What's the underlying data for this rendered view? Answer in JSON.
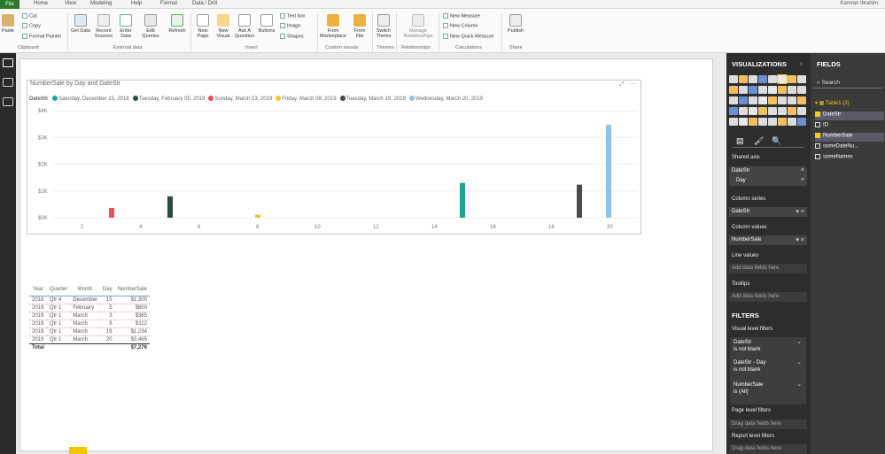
{
  "tabs": {
    "file": "File",
    "home": "Home",
    "view": "View",
    "modeling": "Modeling",
    "help": "Help",
    "format": "Format",
    "data_drill": "Data / Drill",
    "user": "Kamran Ibrahim"
  },
  "ribbon": {
    "paste": "Paste",
    "cut": "Cut",
    "copy": "Copy",
    "format_painter": "Format Painter",
    "get_data": "Get Data",
    "recent_sources": "Recent Sources",
    "enter_data": "Enter Data",
    "edit_queries": "Edit Queries",
    "refresh": "Refresh",
    "new_page": "New Page",
    "new_visual": "New Visual",
    "ask_question": "Ask A Question",
    "buttons": "Buttons",
    "text_box": "Text box",
    "image": "Image",
    "shapes": "Shapes",
    "from_marketplace": "From Marketplace",
    "from_file": "From File",
    "switch_theme": "Switch Theme",
    "manage_relationships": "Manage Relationships",
    "new_measure": "New Measure",
    "new_column": "New Column",
    "new_quick_measure": "New Quick Measure",
    "publish": "Publish",
    "groups": {
      "clipboard": "Clipboard",
      "external_data": "External data",
      "insert": "Insert",
      "custom_visuals": "Custom visuals",
      "themes": "Themes",
      "relationships": "Relationships",
      "calculations": "Calculations",
      "share": "Share"
    }
  },
  "visual": {
    "title": "NumberSale by Day and DateStr",
    "legend_title": "DateStr",
    "expand_icon": "focus-mode-icon",
    "more_icon": "more-options-icon"
  },
  "legend": [
    {
      "label": "Saturday, December 15, 2018",
      "color": "#1aa692"
    },
    {
      "label": "Tuesday, February 05, 2019",
      "color": "#2f4b40"
    },
    {
      "label": "Sunday, March 03, 2019",
      "color": "#e6505a"
    },
    {
      "label": "Friday, March 08, 2019",
      "color": "#f2c230"
    },
    {
      "label": "Tuesday, March 19, 2019",
      "color": "#4a4a48"
    },
    {
      "label": "Wednesday, March 20, 2019",
      "color": "#8ac3ec"
    }
  ],
  "chart_data": {
    "type": "bar",
    "title": "NumberSale by Day and DateStr",
    "x_ticks": [
      "2",
      "4",
      "6",
      "8",
      "10",
      "12",
      "14",
      "16",
      "18",
      "20"
    ],
    "y_ticks": [
      "$0K",
      "$1K",
      "$2K",
      "$3K",
      "$4K"
    ],
    "xlim": [
      1,
      21
    ],
    "ylim": [
      0,
      4000
    ],
    "series": [
      {
        "name": "Saturday, December 15, 2018",
        "x": 15,
        "y": 1300,
        "color": "#1aa692"
      },
      {
        "name": "Tuesday, February 05, 2019",
        "x": 5,
        "y": 800,
        "color": "#2f4b40"
      },
      {
        "name": "Sunday, March 03, 2019",
        "x": 3,
        "y": 365,
        "color": "#e6505a"
      },
      {
        "name": "Friday, March 08, 2019",
        "x": 8,
        "y": 112,
        "color": "#f2c230"
      },
      {
        "name": "Tuesday, March 19, 2019",
        "x": 19,
        "y": 1234,
        "color": "#4a4a48"
      },
      {
        "name": "Wednesday, March 20, 2019",
        "x": 20,
        "y": 3465,
        "color": "#8ac3ec"
      }
    ]
  },
  "table": {
    "headers": [
      "Year",
      "Quarter",
      "Month",
      "Day",
      "NumberSale"
    ],
    "rows": [
      [
        "2018",
        "Qtr 4",
        "December",
        "15",
        "$1,300"
      ],
      [
        "2019",
        "Qtr 1",
        "February",
        "5",
        "$800"
      ],
      [
        "2019",
        "Qtr 1",
        "March",
        "3",
        "$365"
      ],
      [
        "2019",
        "Qtr 1",
        "March",
        "8",
        "$112"
      ],
      [
        "2019",
        "Qtr 1",
        "March",
        "19",
        "$1,234"
      ],
      [
        "2019",
        "Qtr 1",
        "March",
        "20",
        "$3,465"
      ]
    ],
    "total_label": "Total",
    "total_value": "$7,276"
  },
  "viz_pane": {
    "title": "VISUALIZATIONS",
    "shared_axis": "Shared axis",
    "shared_axis_fields": [
      "DateStr",
      "Day"
    ],
    "column_series": "Column series",
    "column_series_field": "DateStr",
    "column_values": "Column values",
    "column_values_field": "NumberSale",
    "line_values": "Line values",
    "tooltips": "Tooltips",
    "add_fields": "Add data fields here",
    "filters": "FILTERS",
    "visual_level": "Visual level filters",
    "filters_list": [
      {
        "name": "DateStr",
        "cond": "is not blank"
      },
      {
        "name": "DateStr - Day",
        "cond": "is not blank"
      },
      {
        "name": "NumberSale",
        "cond": "is (All)"
      }
    ],
    "page_level": "Page level filters",
    "report_level": "Report level filters",
    "drag_here": "Drag data fields here"
  },
  "fields_pane": {
    "title": "FIELDS",
    "search_placeholder": "Search",
    "table_name": "Table1 (2)",
    "items": [
      {
        "name": "DateStr",
        "checked": true
      },
      {
        "name": "ID",
        "checked": false
      },
      {
        "name": "NumberSale",
        "checked": true
      },
      {
        "name": "someDateNu...",
        "checked": false
      },
      {
        "name": "someNames",
        "checked": false
      }
    ]
  }
}
